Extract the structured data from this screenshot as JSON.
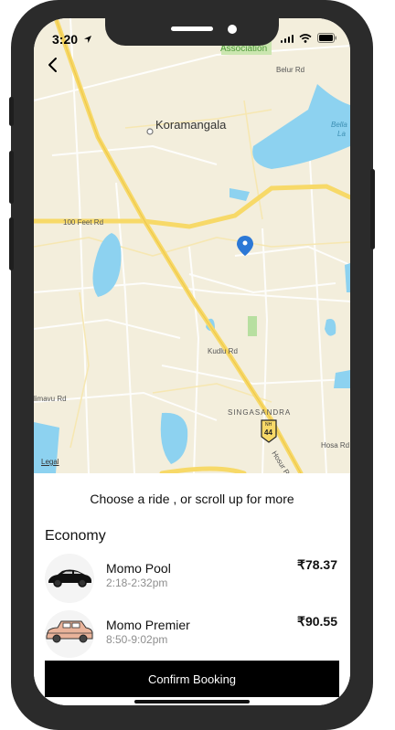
{
  "status_bar": {
    "time": "3:20"
  },
  "map": {
    "labels": {
      "association": "Association",
      "belur_rd": "Belur Rd",
      "koramangala": "Koramangala",
      "bella": "Bella",
      "la": "La",
      "feet_rd": "100 Feet Rd",
      "kudlu_rd": "Kudlu Rd",
      "alimavu_rd": "limavu Rd",
      "singasandra": "SINGASANDRA",
      "nh_top": "NH",
      "nh_num": "44",
      "hosur_rd": "Hosur Rd",
      "hosa_rd": "Hosa Rd",
      "legal": "Legal"
    }
  },
  "sheet": {
    "prompt": "Choose a ride , or scroll up for more",
    "section_title": "Economy",
    "rides": [
      {
        "name": "Momo Pool",
        "time": "2:18-2:32pm",
        "price": "₹78.37"
      },
      {
        "name": "Momo Premier",
        "time": "8:50-9:02pm",
        "price": "₹90.55"
      }
    ],
    "confirm_label": "Confirm Booking"
  },
  "colors": {
    "map_bg": "#f3eedc",
    "water": "#8dd2f0",
    "road": "#f7d968",
    "pin": "#2c78d6"
  }
}
